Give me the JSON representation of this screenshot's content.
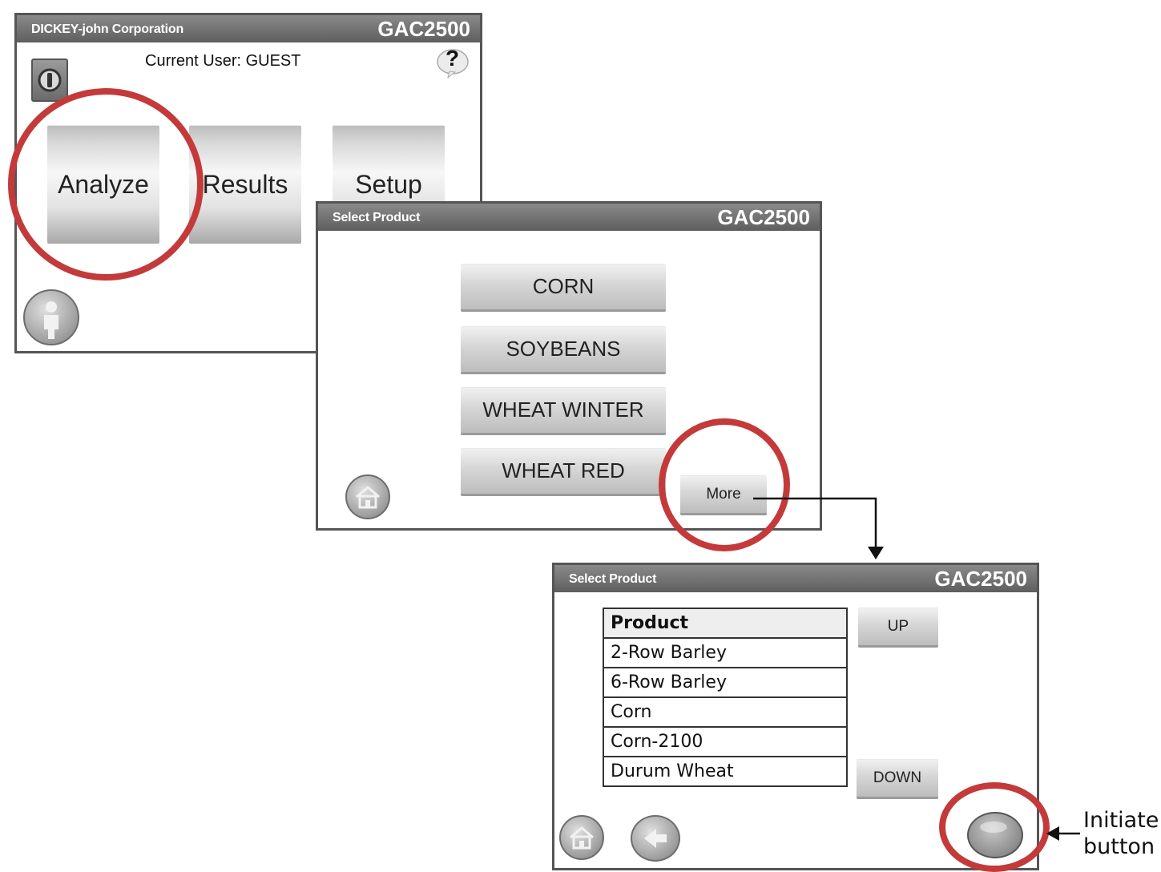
{
  "screen1": {
    "title": "DICKEY-john Corporation",
    "model": "GAC2500",
    "current_user": "Current User: GUEST",
    "help_glyph": "?",
    "buttons": {
      "analyze": "Analyze",
      "results": "Results",
      "setup": "Setup"
    },
    "icons": [
      "power-icon",
      "help-icon",
      "user-icon"
    ]
  },
  "screen2": {
    "title": "Select Product",
    "model": "GAC2500",
    "products": [
      "CORN",
      "SOYBEANS",
      "WHEAT WINTER",
      "WHEAT RED"
    ],
    "more_label": "More",
    "icons": [
      "home-icon"
    ]
  },
  "screen3": {
    "title": "Select Product",
    "model": "GAC2500",
    "table_header": "Product",
    "rows": [
      "2-Row Barley",
      "6-Row Barley",
      "Corn",
      "Corn-2100",
      "Durum Wheat"
    ],
    "up_label": "UP",
    "down_label": "DOWN",
    "icons": [
      "home-icon",
      "back-arrow-icon",
      "initiate-icon"
    ]
  },
  "annotation": {
    "initiate_line1": "Initiate",
    "initiate_line2": "button"
  },
  "colors": {
    "highlight_ring": "#c43a3a",
    "titlebar": "#6e6e6e"
  }
}
